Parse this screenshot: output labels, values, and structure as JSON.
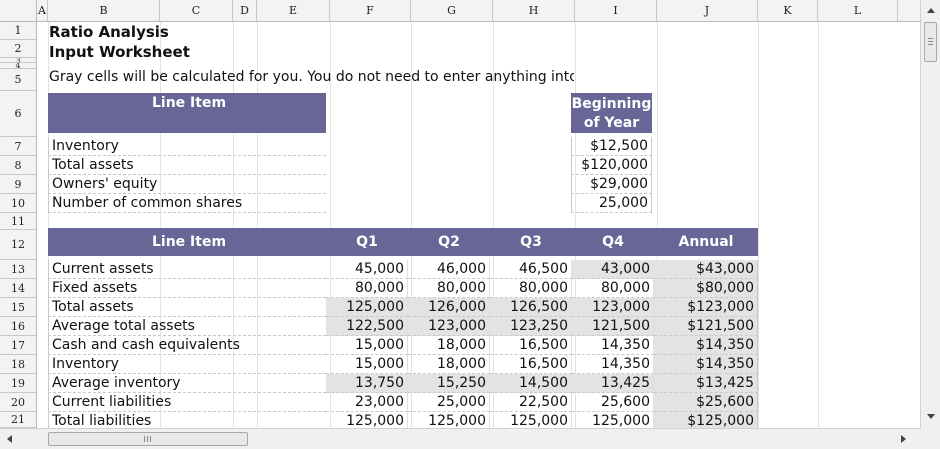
{
  "columns": [
    "A",
    "B",
    "C",
    "D",
    "E",
    "F",
    "G",
    "H",
    "I",
    "J",
    "K",
    "L"
  ],
  "rows": [
    "1",
    "2",
    "3",
    "4",
    "5",
    "6",
    "7",
    "8",
    "9",
    "10",
    "11",
    "12",
    "13",
    "14",
    "15",
    "16",
    "17",
    "18",
    "19",
    "20",
    "21"
  ],
  "sheet": {
    "title1": "Ratio Analysis",
    "title2": "Input Worksheet",
    "note": "Gray cells will be calculated for you. You do not need to enter anything into",
    "section1": {
      "header_line_item": "Line Item",
      "header_beginning_1": "Beginning",
      "header_beginning_2": "of Year",
      "items": [
        {
          "label": "Inventory",
          "value": "$12,500"
        },
        {
          "label": "Total assets",
          "value": "$120,000"
        },
        {
          "label": "Owners' equity",
          "value": "$29,000"
        },
        {
          "label": "Number of common shares",
          "value": "25,000"
        }
      ]
    },
    "section2": {
      "headers": {
        "line_item": "Line Item",
        "q1": "Q1",
        "q2": "Q2",
        "q3": "Q3",
        "q4": "Q4",
        "annual": "Annual"
      },
      "rows": [
        {
          "label": "Current assets",
          "q1": "45,000",
          "q2": "46,000",
          "q3": "46,500",
          "q4": "43,000",
          "annual": "$43,000",
          "gray": [
            false,
            false,
            false,
            true
          ]
        },
        {
          "label": "Fixed assets",
          "q1": "80,000",
          "q2": "80,000",
          "q3": "80,000",
          "q4": "80,000",
          "annual": "$80,000",
          "gray": [
            false,
            false,
            false,
            false
          ]
        },
        {
          "label": "Total assets",
          "q1": "125,000",
          "q2": "126,000",
          "q3": "126,500",
          "q4": "123,000",
          "annual": "$123,000",
          "gray": [
            true,
            true,
            true,
            true
          ]
        },
        {
          "label": "Average total assets",
          "q1": "122,500",
          "q2": "123,000",
          "q3": "123,250",
          "q4": "121,500",
          "annual": "$121,500",
          "gray": [
            true,
            true,
            true,
            true
          ]
        },
        {
          "label": "Cash and cash equivalents",
          "q1": "15,000",
          "q2": "18,000",
          "q3": "16,500",
          "q4": "14,350",
          "annual": "$14,350",
          "gray": [
            false,
            false,
            false,
            false
          ]
        },
        {
          "label": "Inventory",
          "q1": "15,000",
          "q2": "18,000",
          "q3": "16,500",
          "q4": "14,350",
          "annual": "$14,350",
          "gray": [
            false,
            false,
            false,
            false
          ]
        },
        {
          "label": "Average inventory",
          "q1": "13,750",
          "q2": "15,250",
          "q3": "14,500",
          "q4": "13,425",
          "annual": "$13,425",
          "gray": [
            true,
            true,
            true,
            true
          ]
        },
        {
          "label": "Current liabilities",
          "q1": "23,000",
          "q2": "25,000",
          "q3": "22,500",
          "q4": "25,600",
          "annual": "$25,600",
          "gray": [
            false,
            false,
            false,
            false
          ]
        },
        {
          "label": "Total liabilities",
          "q1": "125,000",
          "q2": "125,000",
          "q3": "125,000",
          "q4": "125,000",
          "annual": "$125,000",
          "gray": [
            false,
            false,
            false,
            false
          ]
        }
      ]
    }
  },
  "colors": {
    "header_bg": "#676696",
    "calc_gray": "#e3e3e3"
  },
  "icons": {
    "scroll_up": "triangle-up",
    "scroll_down": "triangle-down",
    "scroll_left": "triangle-left",
    "scroll_right": "triangle-right"
  }
}
